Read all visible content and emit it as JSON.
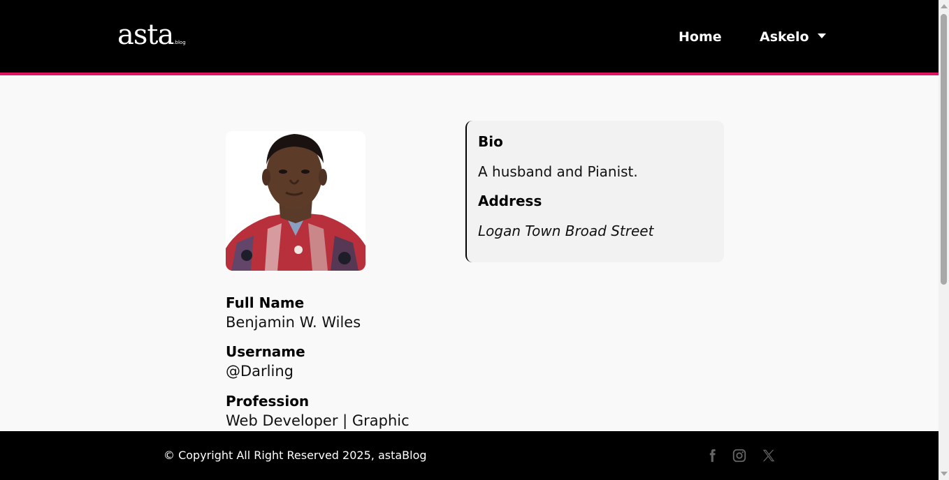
{
  "header": {
    "logo_text": "asta",
    "logo_suffix": ".blog",
    "nav": {
      "home_label": "Home",
      "user_label": "Askelo"
    }
  },
  "profile": {
    "avatar_alt": "profile photo",
    "fields": [
      {
        "label": "Full Name",
        "value": "Benjamin W. Wiles"
      },
      {
        "label": "Username",
        "value": "@Darling"
      },
      {
        "label": "Profession",
        "value": "Web Developer | Graphic"
      }
    ],
    "bio": {
      "bio_label": "Bio",
      "bio_text": "A husband and Pianist.",
      "address_label": "Address",
      "address_text": "Logan Town Broad Street"
    }
  },
  "footer": {
    "copyright": "© Copyright All Right Reserved 2025, astaBlog",
    "social_icons": [
      "facebook-icon",
      "instagram-icon",
      "x-icon"
    ]
  },
  "colors": {
    "header_bg": "#000000",
    "accent": "#e0145f",
    "page_bg": "#f9f9f9",
    "card_bg": "#f2f2f2"
  }
}
